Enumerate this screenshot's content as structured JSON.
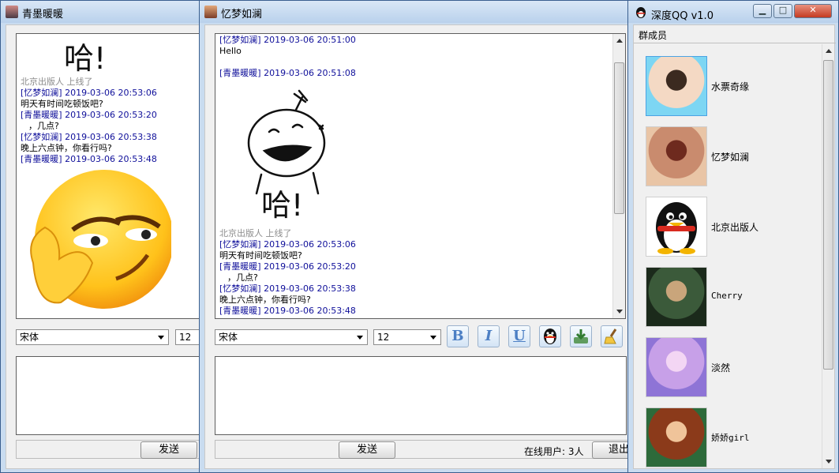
{
  "win_left": {
    "title": "青墨暖暖",
    "sticker_text": "哈!",
    "messages": [
      {
        "type": "sys",
        "text": "北京出版人 上线了"
      },
      {
        "type": "meta",
        "text": "[忆梦如澜] 2019-03-06 20:53:06"
      },
      {
        "type": "body",
        "text": "明天有时间吃顿饭吧?"
      },
      {
        "type": "meta",
        "text": "[青墨暖暖] 2019-03-06 20:53:20"
      },
      {
        "type": "body",
        "text": "，几点?"
      },
      {
        "type": "meta",
        "text": "[忆梦如澜] 2019-03-06 20:53:38"
      },
      {
        "type": "body",
        "text": "晚上六点钟，你看行吗?"
      },
      {
        "type": "meta",
        "text": "[青墨暖暖] 2019-03-06 20:53:48"
      }
    ],
    "font_value": "宋体",
    "size_value": "12",
    "send_label": "发送"
  },
  "win_mid": {
    "title": "忆梦如澜",
    "messages": [
      {
        "type": "meta",
        "text": "[忆梦如澜] 2019-03-06 20:51:00"
      },
      {
        "type": "body",
        "text": "Hello"
      },
      {
        "type": "meta",
        "text": "[青墨暖暖] 2019-03-06 20:51:08"
      },
      {
        "type": "sys",
        "text": "北京出版人 上线了"
      },
      {
        "type": "meta",
        "text": "[忆梦如澜] 2019-03-06 20:53:06"
      },
      {
        "type": "body",
        "text": "明天有时间吃顿饭吧?"
      },
      {
        "type": "meta",
        "text": "[青墨暖暖] 2019-03-06 20:53:20"
      },
      {
        "type": "body",
        "text": "，几点?"
      },
      {
        "type": "meta",
        "text": "[忆梦如澜] 2019-03-06 20:53:38"
      },
      {
        "type": "body",
        "text": "晚上六点钟，你看行吗?"
      },
      {
        "type": "meta",
        "text": "[青墨暖暖] 2019-03-06 20:53:48"
      }
    ],
    "sticker_text": "哈!",
    "font_value": "宋体",
    "size_value": "12",
    "tools": {
      "bold": "B",
      "italic": "I",
      "underline": "U"
    },
    "send_label": "发送",
    "online_label": "在线用户: 3人",
    "exit_label": "退出"
  },
  "win_right": {
    "title": "深度QQ v1.0",
    "group_header": "群成员",
    "members": [
      {
        "name": "水票奇缘"
      },
      {
        "name": "忆梦如澜"
      },
      {
        "name": "北京出版人"
      },
      {
        "name": "Cherry"
      },
      {
        "name": "淡然"
      },
      {
        "name": "娇娇girl"
      }
    ]
  }
}
